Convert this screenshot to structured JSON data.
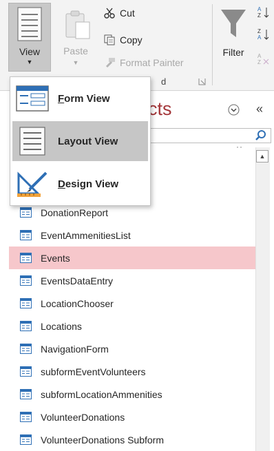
{
  "ribbon": {
    "view": {
      "label": "View"
    },
    "paste": {
      "label": "Paste"
    },
    "clipboard": [
      {
        "label": "Cut",
        "icon": "scissors-icon",
        "enabled": true
      },
      {
        "label": "Copy",
        "icon": "copy-icon",
        "enabled": true
      },
      {
        "label": "Format Painter",
        "icon": "format-painter-icon",
        "enabled": false
      }
    ],
    "filter": {
      "label": "Filter"
    },
    "group_label_fragment": "d"
  },
  "view_menu": {
    "items": [
      {
        "mnemonic": "F",
        "rest": "orm View",
        "icon": "form-view-icon",
        "hover": false
      },
      {
        "mnemonic": "",
        "rest": "Layout View",
        "icon": "layout-view-icon",
        "hover": true
      },
      {
        "mnemonic": "D",
        "rest": "esign View",
        "icon": "design-view-icon",
        "hover": false
      }
    ]
  },
  "nav": {
    "title_fragment": "ects",
    "collapse_glyph": "«",
    "items": [
      {
        "label": "DonationReport",
        "selected": false
      },
      {
        "label": "EventAmmenitiesList",
        "selected": false
      },
      {
        "label": "Events",
        "selected": true
      },
      {
        "label": "EventsDataEntry",
        "selected": false
      },
      {
        "label": "LocationChooser",
        "selected": false
      },
      {
        "label": "Locations",
        "selected": false
      },
      {
        "label": "NavigationForm",
        "selected": false
      },
      {
        "label": "subformEventVolunteers",
        "selected": false
      },
      {
        "label": "subformLocationAmmenities",
        "selected": false
      },
      {
        "label": "VolunteerDonations",
        "selected": false
      },
      {
        "label": "VolunteerDonations Subform",
        "selected": false
      }
    ]
  },
  "colors": {
    "accent": "#a4373a",
    "selected_row": "#f6c7cb",
    "menu_hover": "#c6c6c6",
    "form_icon_blue": "#2e6fb5"
  }
}
